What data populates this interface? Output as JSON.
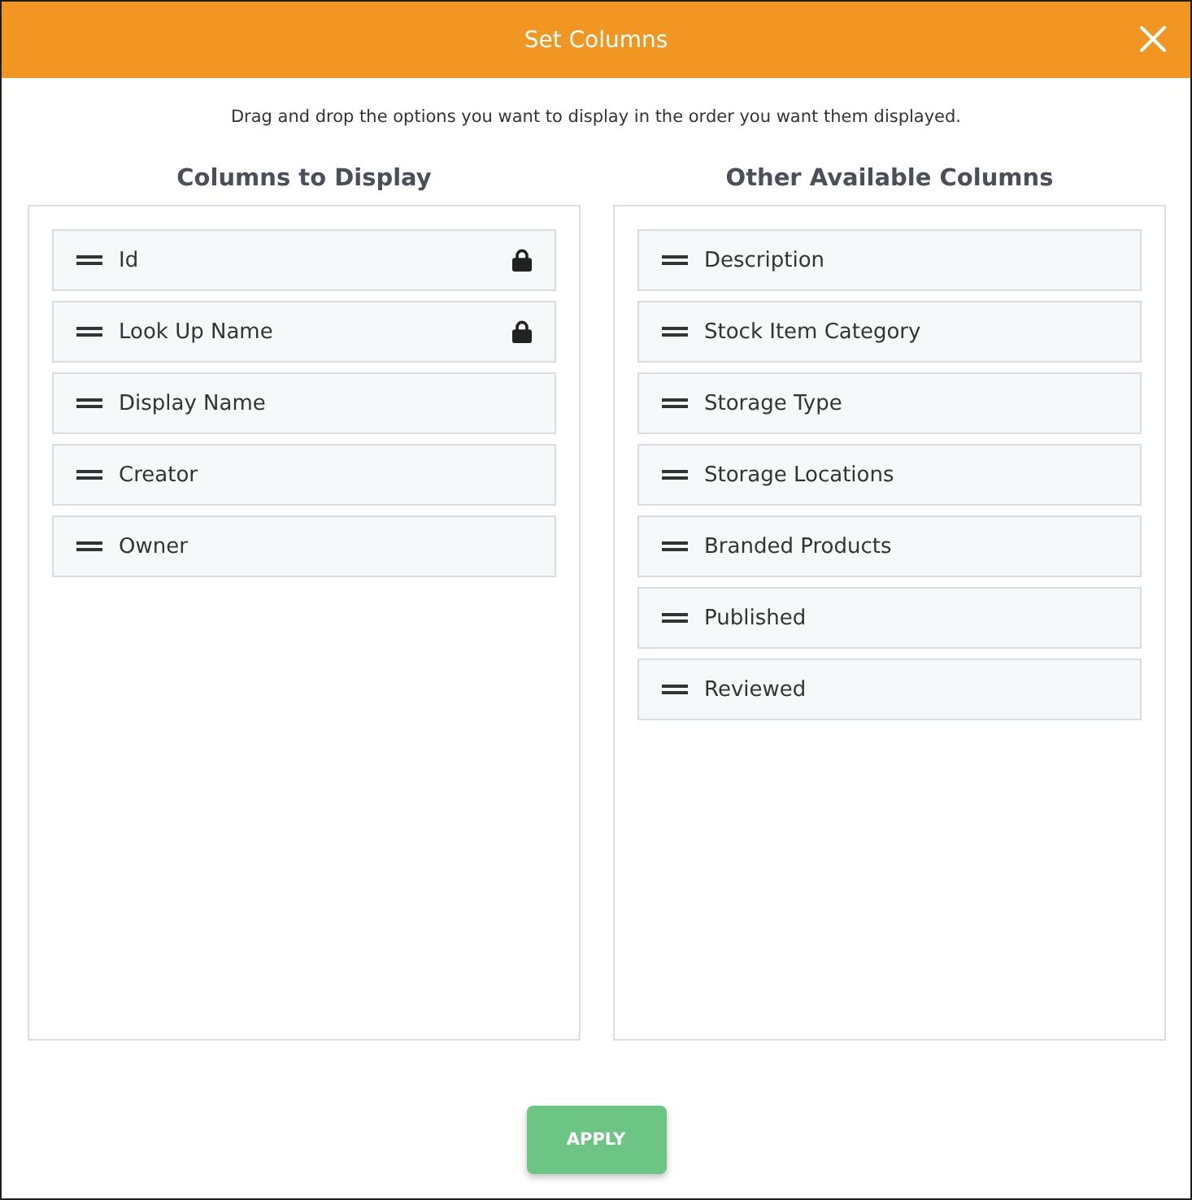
{
  "dialog": {
    "title": "Set Columns",
    "instruction": "Drag and drop the options you want to display in the order you want them displayed.",
    "columns_to_display": {
      "heading": "Columns to Display",
      "items": [
        {
          "label": "Id",
          "locked": true
        },
        {
          "label": "Look Up Name",
          "locked": true
        },
        {
          "label": "Display Name",
          "locked": false
        },
        {
          "label": "Creator",
          "locked": false
        },
        {
          "label": "Owner",
          "locked": false
        }
      ]
    },
    "other_available_columns": {
      "heading": "Other Available Columns",
      "items": [
        {
          "label": "Description",
          "locked": false
        },
        {
          "label": "Stock Item Category",
          "locked": false
        },
        {
          "label": "Storage Type",
          "locked": false
        },
        {
          "label": "Storage Locations",
          "locked": false
        },
        {
          "label": "Branded Products",
          "locked": false
        },
        {
          "label": "Published",
          "locked": false
        },
        {
          "label": "Reviewed",
          "locked": false
        }
      ]
    },
    "apply_button": "APPLY"
  }
}
